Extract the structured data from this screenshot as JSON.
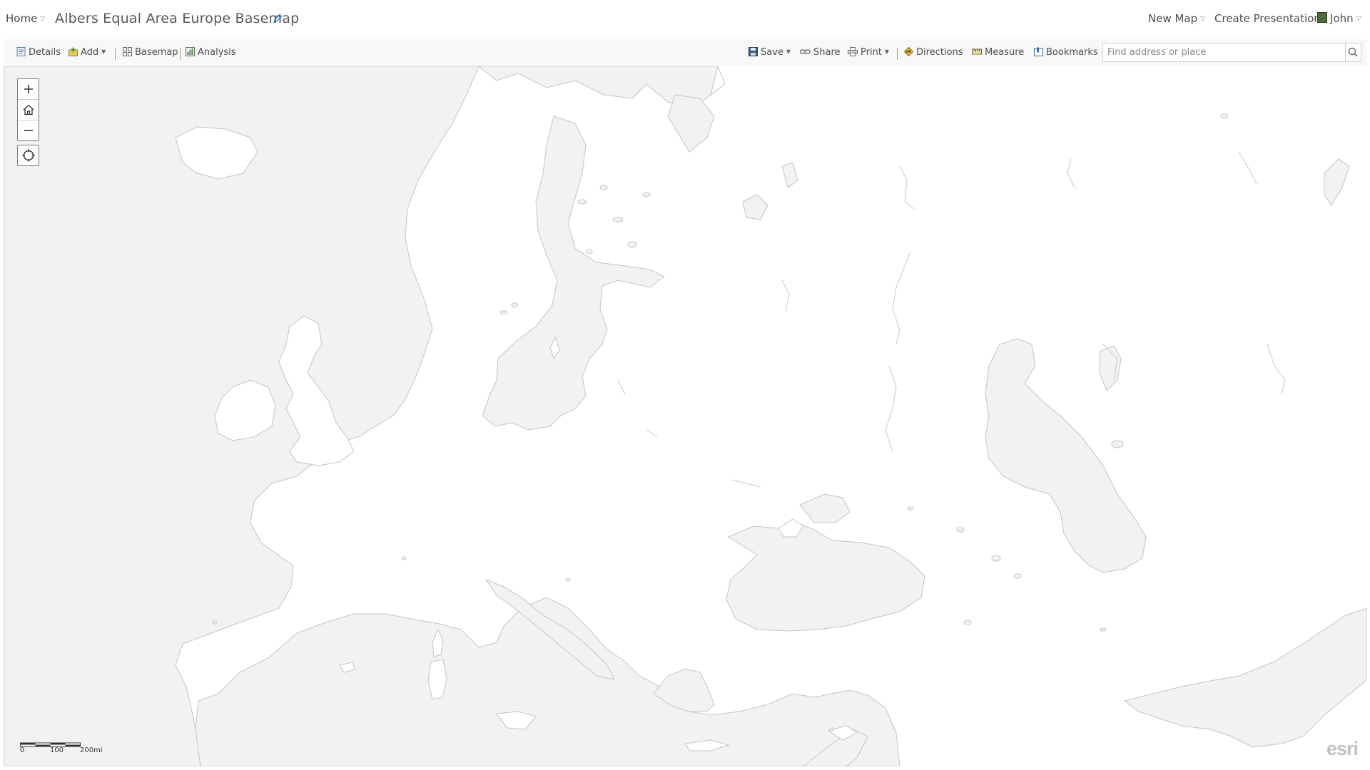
{
  "nav": {
    "home_label": "Home",
    "map_title": "Albers Equal Area Europe Basemap",
    "new_map_label": "New Map",
    "create_presentation_label": "Create Presentation",
    "user_label": "John"
  },
  "toolbar": {
    "details_label": "Details",
    "add_label": "Add",
    "basemap_label": "Basemap",
    "analysis_label": "Analysis",
    "save_label": "Save",
    "share_label": "Share",
    "print_label": "Print",
    "directions_label": "Directions",
    "measure_label": "Measure",
    "bookmarks_label": "Bookmarks"
  },
  "search": {
    "placeholder": "Find address or place",
    "value": ""
  },
  "map": {
    "scale_labels": [
      "0",
      "100",
      "200mi"
    ],
    "attribution_logo": "esri",
    "land_color": "#ffffff",
    "water_color": "#f2f2f2",
    "coast_color": "#bfbfbf"
  },
  "icons": {
    "zoom_in": "plus-icon",
    "home": "home-icon",
    "zoom_out": "minus-icon",
    "locate": "locate-icon",
    "search": "search-icon",
    "edit_title": "pencil-icon"
  }
}
